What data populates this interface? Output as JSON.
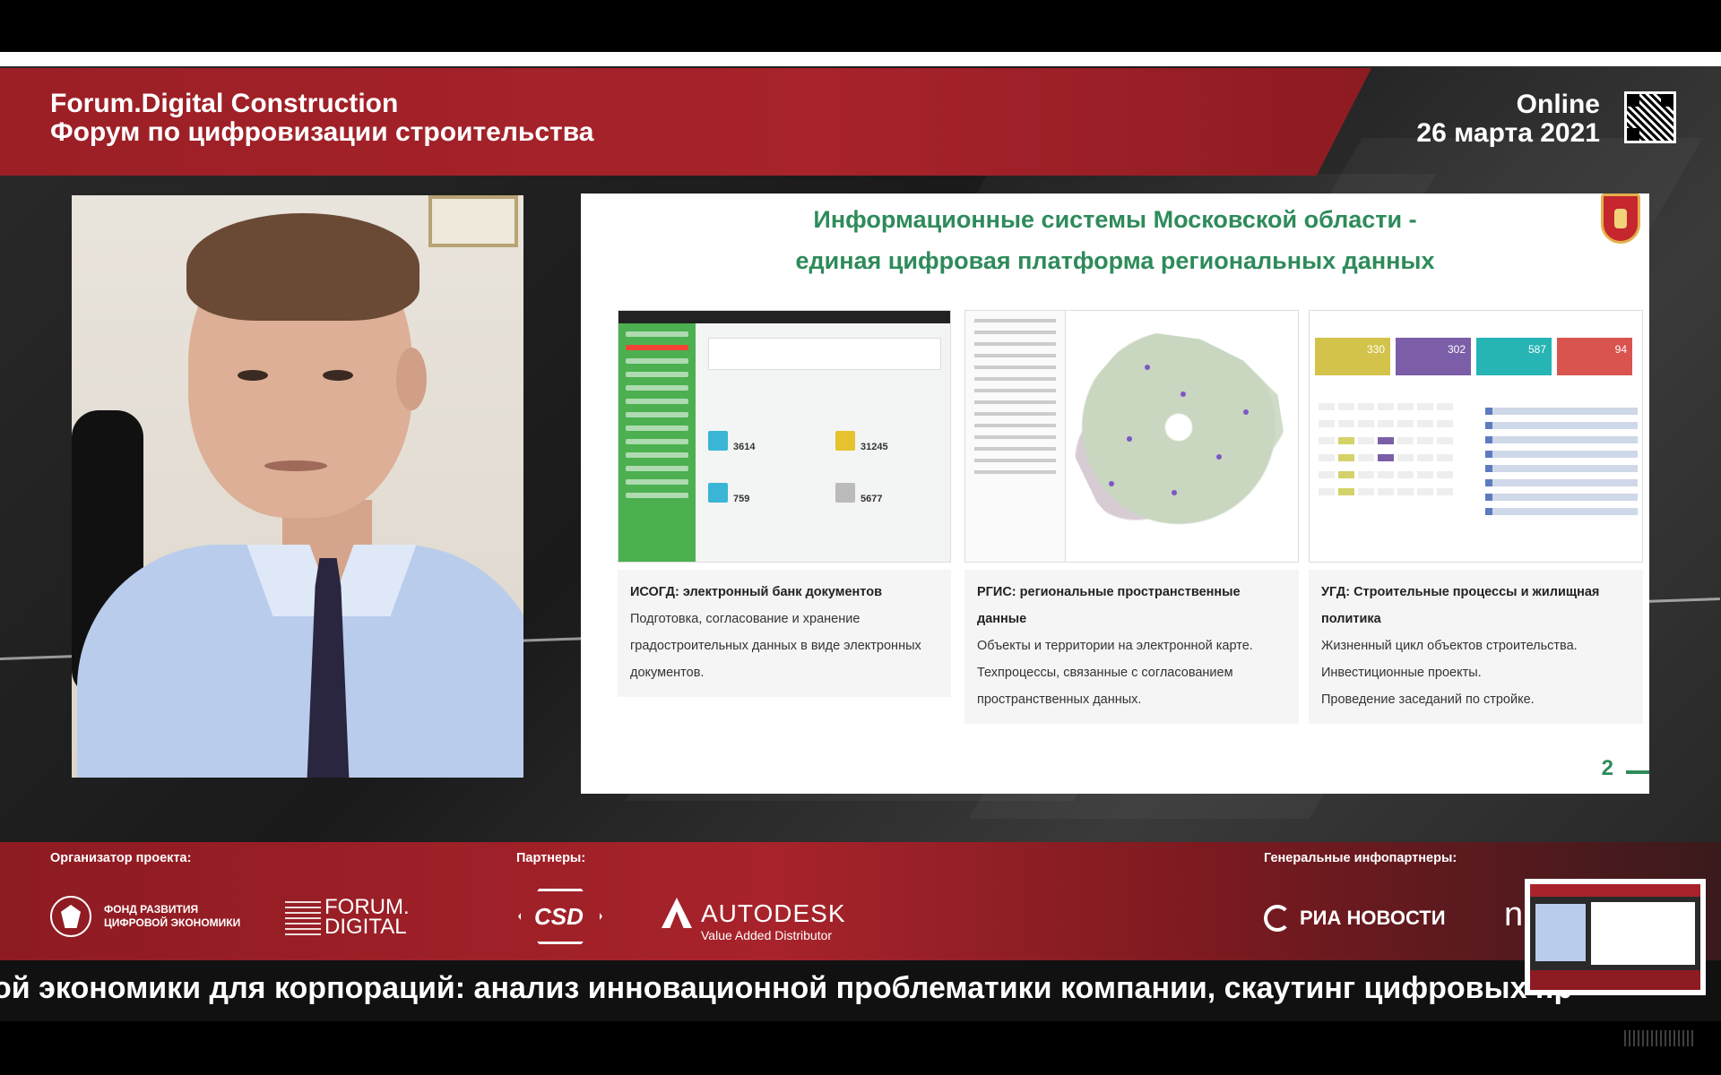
{
  "header": {
    "title": "Forum.Digital Construction",
    "subtitle": "Форум по цифровизации строительства",
    "online": "Online",
    "date": "26 марта 2021"
  },
  "slide": {
    "title_line1": "Информационные системы Московской области -",
    "title_line2": "единая цифровая платформа региональных данных",
    "page_number": "2",
    "thumb1": {
      "stats": [
        "3614",
        "31245",
        "759",
        "5677"
      ]
    },
    "thumb3": {
      "tiles": [
        "330",
        "302",
        "587",
        "94"
      ],
      "tile_colors": [
        "#d4c34a",
        "#7b5ea7",
        "#26b4b4",
        "#d9534f"
      ]
    },
    "cards": [
      {
        "heading": "ИСОГД: электронный банк документов",
        "lines": [
          "Подготовка, согласование и хранение",
          "градостроительных данных в виде электронных",
          "документов."
        ]
      },
      {
        "heading_line1": "РГИС: региональные пространственные",
        "heading_line2": "данные",
        "lines": [
          "Объекты и территории на электронной карте.",
          "Техпроцессы, связанные с согласованием",
          "пространственных данных."
        ]
      },
      {
        "heading_line1": "УГД: Строительные процессы и жилищная",
        "heading_line2": "политика",
        "lines": [
          "Жизненный цикл объектов строительства.",
          "Инвестиционные проекты.",
          "Проведение заседаний по стройке."
        ]
      }
    ]
  },
  "sponsors": {
    "organizer_label": "Организатор проекта:",
    "partners_label": "Партнеры:",
    "infopartners_label": "Генеральные инфопартнеры:",
    "fund_line1": "ФОНД РАЗВИТИЯ",
    "fund_line2": "ЦИФРОВОЙ ЭКОНОМИКИ",
    "forum_line1": "FORUM.",
    "forum_line2": "DIGITAL",
    "csd": "CSD",
    "autodesk": "AUTODESK",
    "autodesk_sub": "Value Added Distributor",
    "ria": "РИА НОВОСТИ",
    "partial": "n"
  },
  "ticker": {
    "text": "ой экономики для корпораций: анализ инновационной проблематики компании, скаутинг цифровых пр"
  },
  "colors": {
    "brand_red": "#a8232b",
    "slide_green": "#2e8b5a"
  }
}
